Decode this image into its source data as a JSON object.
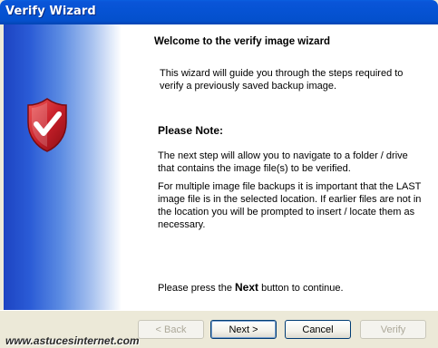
{
  "window": {
    "title": "Verify Wizard"
  },
  "wizard": {
    "heading": "Welcome to the verify image wizard",
    "intro": "This wizard will guide you through the steps required to verify a previously saved backup image.",
    "note_title": "Please Note:",
    "note_paragraph_1": "The next step will allow you to navigate to a folder / drive that contains the image file(s) to be verified.",
    "note_paragraph_2": "For multiple image file backups it is important that the LAST image file is in the selected location. If earlier files are not in the location you will be prompted to insert / locate them as necessary.",
    "press_prefix": "Please press the ",
    "press_keyword": "Next",
    "press_suffix": " button to continue."
  },
  "buttons": {
    "back": "< Back",
    "next": "Next >",
    "cancel": "Cancel",
    "verify": "Verify"
  },
  "watermark": "www.astucesinternet.com",
  "icons": {
    "side": "shield-checkmark-icon"
  },
  "colors": {
    "titlebar": "#0653d4",
    "shield_red": "#c8202a",
    "side_panel_blue": "#2a5bd6"
  }
}
